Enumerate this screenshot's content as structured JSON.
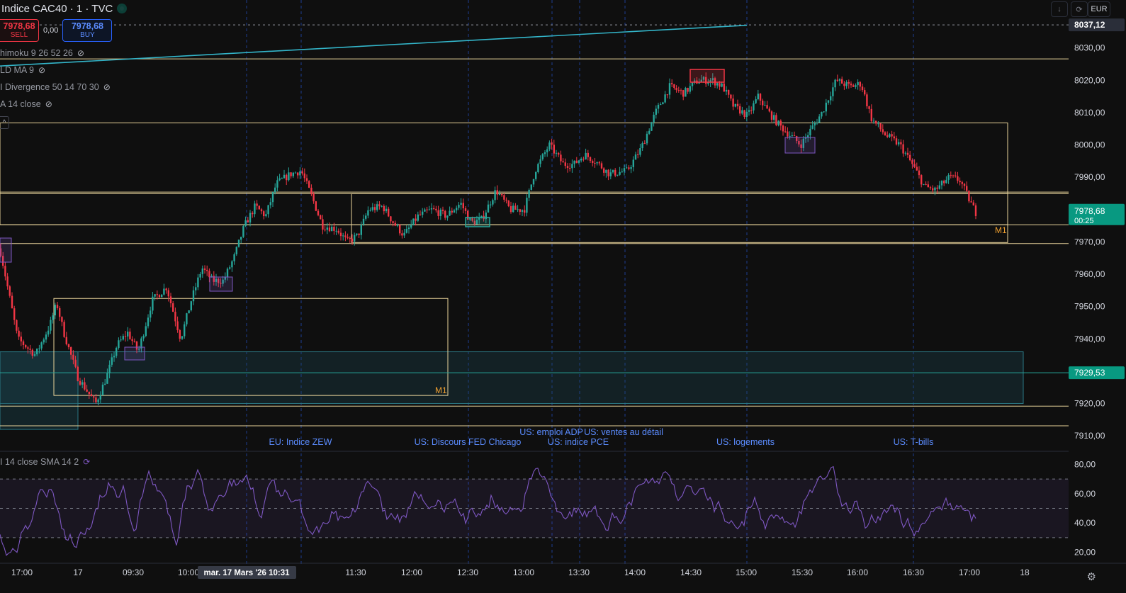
{
  "header": {
    "symbol": "Indice CAC40 · 1 · TVC",
    "sell_price": "7978,68",
    "sell_label": "SELL",
    "spread": "0,00",
    "buy_price": "7978,68",
    "buy_label": "BUY",
    "currency": "EUR",
    "dropdown_glyph": "↓",
    "replay_glyph": "⟳",
    "collapse_glyph": "^",
    "eye_glyph": "⊘",
    "settings_glyph": "⚙"
  },
  "indicators": [
    {
      "label": "himoku 9 26 52 26"
    },
    {
      "label": "LD MA 9"
    },
    {
      "label": "I Divergence 50 14 70 30"
    },
    {
      "label": "A 14 close"
    }
  ],
  "rsi_label": "I 14 close SMA 14 2",
  "colors": {
    "up": "#26a69a",
    "down": "#f23645",
    "rsi": "#7e57c2",
    "zone": "#e8d39a",
    "accent": "#2962ff",
    "trend": "#33b5c9"
  },
  "chart_data": {
    "type": "candlestick",
    "price_axis": {
      "min": 7905,
      "max": 8040,
      "ticks": [
        8030,
        8020,
        8010,
        8000,
        7990,
        7980,
        7970,
        7960,
        7950,
        7940,
        7930,
        7920,
        7910
      ],
      "tick_labels": [
        "8030,00",
        "8020,00",
        "8010,00",
        "8000,00",
        "7990,00",
        "7980,00",
        "7970,00",
        "7960,00",
        "7950,00",
        "7940,00",
        "7930,00",
        "7920,00",
        "7910,00"
      ]
    },
    "time_axis": {
      "labels": [
        "17:00",
        "17",
        "09:30",
        "10:00",
        "11:30",
        "12:00",
        "12:30",
        "13:00",
        "13:30",
        "14:00",
        "14:30",
        "15:00",
        "15:30",
        "16:00",
        "16:30",
        "17:00",
        "18"
      ],
      "crosshair_label": "mar. 17 Mars '26   10:31"
    },
    "price_labels": [
      {
        "text": "8037,12",
        "value": 8037.12,
        "kind": "dashed"
      },
      {
        "text": "7978,68",
        "sub": "00:25",
        "value": 7978.68,
        "kind": "last"
      },
      {
        "text": "7929,53",
        "value": 7929.53,
        "kind": "green"
      }
    ],
    "horizontal_lines": [
      8026.6,
      7985.4,
      7984.9,
      7975.3,
      7969.5,
      7919.2,
      7913.1
    ],
    "zones": [
      {
        "label": "M1",
        "top": 8006.8,
        "bottom": 7969.8
      },
      {
        "label": "M1",
        "top": 7952.5,
        "bottom": 7922.5
      }
    ],
    "events": [
      {
        "label": "EU: Indice ZEW",
        "row": 2
      },
      {
        "label": "US: Discours FED Chicago",
        "row": 2
      },
      {
        "label": "US: emploi ADP",
        "row": 1
      },
      {
        "label": "US: ventes au détail",
        "row": 1
      },
      {
        "label": "US: indice PCE",
        "row": 2
      },
      {
        "label": "US: logements",
        "row": 2
      },
      {
        "label": "US: T-bills",
        "row": 2
      }
    ],
    "path": [
      [
        0,
        7968
      ],
      [
        25,
        7940
      ],
      [
        50,
        7935
      ],
      [
        70,
        7944
      ],
      [
        80,
        7951
      ],
      [
        90,
        7942
      ],
      [
        110,
        7928
      ],
      [
        135,
        7920
      ],
      [
        150,
        7928
      ],
      [
        165,
        7938
      ],
      [
        180,
        7942
      ],
      [
        195,
        7936
      ],
      [
        215,
        7952
      ],
      [
        235,
        7956
      ],
      [
        255,
        7940
      ],
      [
        270,
        7952
      ],
      [
        285,
        7962
      ],
      [
        300,
        7958
      ],
      [
        315,
        7958
      ],
      [
        330,
        7965
      ],
      [
        345,
        7975
      ],
      [
        360,
        7981
      ],
      [
        375,
        7978
      ],
      [
        390,
        7988
      ],
      [
        410,
        7991
      ],
      [
        425,
        7992
      ],
      [
        440,
        7984
      ],
      [
        455,
        7975
      ],
      [
        475,
        7974
      ],
      [
        490,
        7970
      ],
      [
        505,
        7972
      ],
      [
        520,
        7980
      ],
      [
        540,
        7981
      ],
      [
        555,
        7976
      ],
      [
        570,
        7972
      ],
      [
        590,
        7978
      ],
      [
        610,
        7980
      ],
      [
        630,
        7978
      ],
      [
        650,
        7982
      ],
      [
        665,
        7976
      ],
      [
        680,
        7977
      ],
      [
        700,
        7986
      ],
      [
        720,
        7980
      ],
      [
        740,
        7980
      ],
      [
        755,
        7992
      ],
      [
        775,
        8000
      ],
      [
        795,
        7994
      ],
      [
        810,
        7994
      ],
      [
        825,
        7997
      ],
      [
        840,
        7995
      ],
      [
        860,
        7991
      ],
      [
        885,
        7992
      ],
      [
        905,
        7999
      ],
      [
        925,
        8010
      ],
      [
        945,
        8018
      ],
      [
        965,
        8016
      ],
      [
        985,
        8020
      ],
      [
        1005,
        8020
      ],
      [
        1020,
        8018
      ],
      [
        1035,
        8012
      ],
      [
        1055,
        8009
      ],
      [
        1070,
        8015
      ],
      [
        1085,
        8010
      ],
      [
        1100,
        8006
      ],
      [
        1115,
        8003
      ],
      [
        1130,
        8000
      ],
      [
        1145,
        8005
      ],
      [
        1160,
        8010
      ],
      [
        1180,
        8020
      ],
      [
        1200,
        8018
      ],
      [
        1215,
        8019
      ],
      [
        1230,
        8008
      ],
      [
        1250,
        8003
      ],
      [
        1270,
        8000
      ],
      [
        1290,
        7993
      ],
      [
        1305,
        7987
      ],
      [
        1320,
        7986
      ],
      [
        1340,
        7990
      ],
      [
        1355,
        7989
      ],
      [
        1370,
        7982
      ],
      [
        1378,
        7978.68
      ]
    ],
    "rsi": {
      "axis_ticks": [
        80,
        60,
        40,
        20
      ],
      "tick_labels": [
        "80,00",
        "60,00",
        "40,00",
        "20,00"
      ],
      "levels": [
        70,
        50,
        30
      ]
    }
  }
}
